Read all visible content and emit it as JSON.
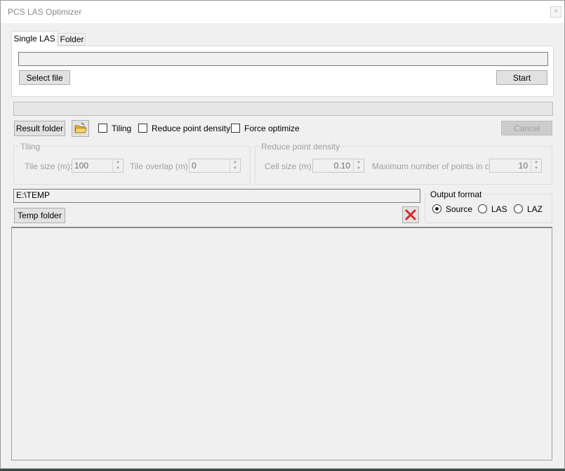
{
  "window": {
    "title": "PCS LAS Optimizer",
    "close_glyph": "×"
  },
  "tabs": [
    {
      "label": "Single LAS",
      "active": true
    },
    {
      "label": "Folder",
      "active": false
    }
  ],
  "single_las": {
    "file_path_value": "",
    "select_file_label": "Select file",
    "start_label": "Start"
  },
  "progress": {
    "value": ""
  },
  "options_row": {
    "result_folder_label": "Result folder",
    "open_folder_icon": "open-folder-icon",
    "tiling_label": "Tiling",
    "tiling_checked": false,
    "reduce_density_label": "Reduce point density",
    "reduce_density_checked": false,
    "force_optimize_label": "Force optimize",
    "force_optimize_checked": false,
    "cancel_label": "Cancel"
  },
  "tiling_group": {
    "title": "Tiling",
    "tile_size_label": "Tile size (m):",
    "tile_size_value": "100",
    "tile_overlap_label": "Tile overlap (m):",
    "tile_overlap_value": "0"
  },
  "density_group": {
    "title": "Reduce point density",
    "cell_size_label": "Cell size (m):",
    "cell_size_value": "0.10",
    "max_points_label": "Maximum number of points in cell:",
    "max_points_value": "10"
  },
  "temp": {
    "path_value": "E:\\TEMP",
    "temp_folder_label": "Temp folder",
    "delete_icon": "red-x-icon"
  },
  "output_format": {
    "title": "Output format",
    "options": [
      {
        "label": "Source",
        "selected": true
      },
      {
        "label": "LAS",
        "selected": false
      },
      {
        "label": "LAZ",
        "selected": false
      }
    ]
  },
  "colors": {
    "delete_icon": "#d9262c",
    "folder_icon": "#e9b63a"
  }
}
